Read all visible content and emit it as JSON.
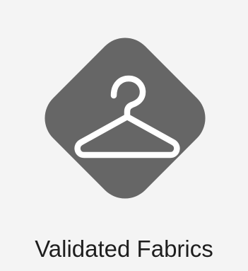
{
  "tile": {
    "label": "Validated Fabrics",
    "icon": "hanger-icon",
    "badge_color": "#666666",
    "icon_color": "#ffffff",
    "label_color": "#1e1e1e",
    "background_color": "#f4f4f4"
  }
}
